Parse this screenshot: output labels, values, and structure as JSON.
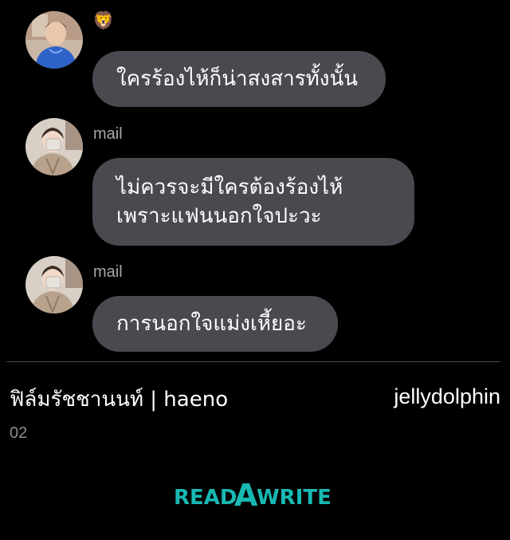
{
  "messages": [
    {
      "sender_emoji": "🦁",
      "sender_name": "",
      "avatar": "avatar-blue-hoodie",
      "lines": [
        "ใครร้องไห้ก็น่าสงสารทั้งนั้น"
      ]
    },
    {
      "sender_name": "mail",
      "avatar": "avatar-beige-coat",
      "lines": [
        "ไม่ควรจะมีใครต้องร้องไห้",
        "เพราะแฟนนอกใจปะวะ"
      ]
    },
    {
      "sender_name": "mail",
      "avatar": "avatar-beige-coat",
      "lines": [
        "การนอกใจแม่งเหี้ยอะ"
      ]
    }
  ],
  "footer": {
    "author": "ฟิล์มรัชชานนท์ | haeno",
    "username": "jellydolphin",
    "page": "02"
  },
  "branding": {
    "logo_text": "READAWRITE",
    "logo_parts": [
      "READ",
      "A",
      "WRITE"
    ],
    "logo_color": "#18b9b2"
  },
  "colors": {
    "background": "#000000",
    "bubble": "#484a50",
    "sender_name": "#a7a7ab"
  }
}
